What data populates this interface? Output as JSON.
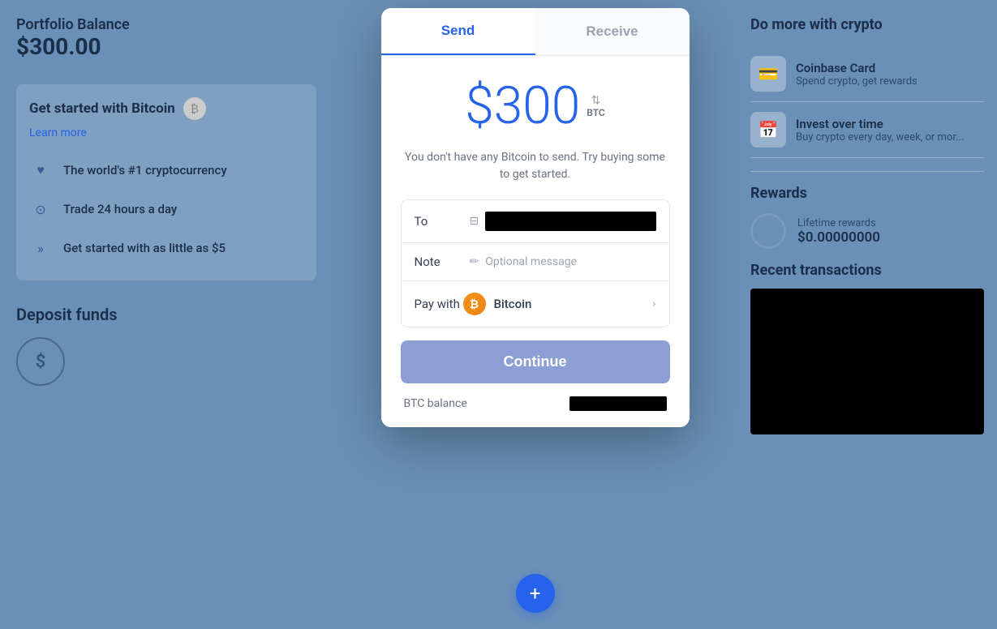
{
  "left": {
    "portfolio_balance_label": "Portfolio Balance",
    "portfolio_balance_amount": "$300.00",
    "get_started_title": "Get started with Bitcoin",
    "learn_more": "Learn more",
    "features": [
      {
        "icon": "♥",
        "icon_name": "heart-icon",
        "text": "The world's #1 cryptocurrency"
      },
      {
        "icon": "⊙",
        "icon_name": "clock-icon",
        "text": "Trade 24 hours a day"
      },
      {
        "icon": "»",
        "icon_name": "chevron-icon",
        "text": "Get started with as little as $5"
      }
    ],
    "deposit_label": "Deposit funds"
  },
  "modal": {
    "tabs": [
      {
        "label": "Send",
        "active": true
      },
      {
        "label": "Receive",
        "active": false
      }
    ],
    "amount": "$300",
    "currency_toggle": "BTC",
    "warning": "You don't have any Bitcoin to send. Try buying some to get started.",
    "to_label": "To",
    "note_label": "Note",
    "note_placeholder": "Optional message",
    "pay_with_label": "Pay with",
    "pay_with_crypto": "Bitcoin",
    "continue_label": "Continue",
    "btc_balance_label": "BTC balance"
  },
  "right": {
    "do_more_title": "Do more with crypto",
    "promos": [
      {
        "icon": "💳",
        "icon_name": "coinbase-card-icon",
        "title": "Coinbase Card",
        "subtitle": "Spend crypto, get rewards"
      },
      {
        "icon": "📅",
        "icon_name": "invest-icon",
        "title": "Invest over time",
        "subtitle": "Buy crypto every day, week, or mor..."
      }
    ],
    "rewards_title": "Rewards",
    "lifetime_label": "Lifetime rewards",
    "lifetime_amount": "$0.00000000",
    "recent_transactions_title": "Recent transactions"
  },
  "fab": "+"
}
